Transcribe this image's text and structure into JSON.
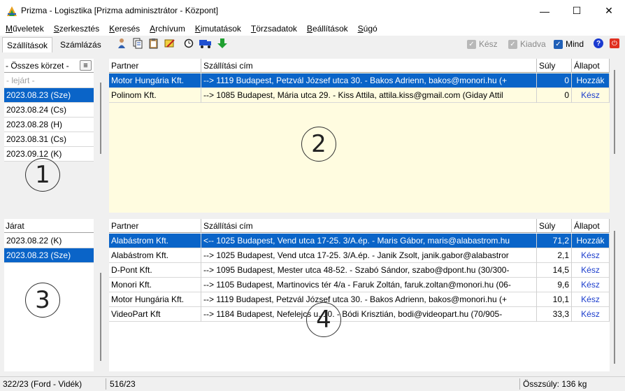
{
  "window": {
    "title": "Prizma - Logisztika [Prizma adminisztrátor - Központ]",
    "minimize": "—",
    "maximize": "☐",
    "close": "✕"
  },
  "menu": [
    {
      "label": "Műveletek",
      "u": "M",
      "rest": "űveletek"
    },
    {
      "label": "Szerkesztés",
      "u": "S",
      "rest": "zerkesztés"
    },
    {
      "label": "Keresés",
      "u": "K",
      "rest": "eresés"
    },
    {
      "label": "Archívum",
      "u": "A",
      "rest": "rchívum"
    },
    {
      "label": "Kimutatások",
      "u": "K",
      "rest": "imutatások"
    },
    {
      "label": "Törzsadatok",
      "u": "T",
      "rest": "örzsadatok"
    },
    {
      "label": "Beállítások",
      "u": "B",
      "rest": "eállítások"
    },
    {
      "label": "Súgó",
      "u": "S",
      "rest": "úgó"
    }
  ],
  "tabs": {
    "shipping": "Szállítások",
    "billing": "Számlázás"
  },
  "toolbar_icons": [
    "person-icon",
    "copy-icon",
    "clipboard-icon",
    "edit-icon",
    "clock-icon",
    "truck-icon",
    "down-arrow-icon"
  ],
  "checkboxes": {
    "done": "Kész",
    "issued": "Kiadva",
    "all": "Mind"
  },
  "help_icon": "?",
  "power_icon": "⏻",
  "districts": {
    "header": "- Összes körzet -",
    "menu_glyph": "≡",
    "items": [
      {
        "label": "- lejárt -",
        "state": "grayed"
      },
      {
        "label": "2023.08.23 (Sze)",
        "state": "selected"
      },
      {
        "label": "2023.08.24 (Cs)",
        "state": ""
      },
      {
        "label": "2023.08.28 (H)",
        "state": ""
      },
      {
        "label": "2023.08.31 (Cs)",
        "state": ""
      },
      {
        "label": "2023.09.12 (K)",
        "state": ""
      }
    ]
  },
  "routes": {
    "header": "Járat",
    "items": [
      {
        "label": "2023.08.22 (K)",
        "state": ""
      },
      {
        "label": "2023.08.23 (Sze)",
        "state": "selected"
      }
    ]
  },
  "grid_columns": {
    "partner": "Partner",
    "address": "Szállítási cím",
    "weight": "Súly",
    "status": "Állapot"
  },
  "grid_top": [
    {
      "partner": "Motor Hungária Kft.",
      "address": "--> 1119 Budapest, Petzvál József utca 30. - Bakos Adrienn, bakos@monori.hu (+",
      "weight": "0",
      "status": "Hozzák",
      "selected": true
    },
    {
      "partner": "Polinom Kft.",
      "address": "--> 1085 Budapest, Mária utca 29. - Kiss Attila, attila.kiss@gmail.com (Giday Attil",
      "weight": "0",
      "status": "Kész",
      "selected": false
    }
  ],
  "grid_bottom": [
    {
      "partner": "Alabástrom Kft.",
      "address": "<-- 1025 Budapest, Vend utca 17-25. 3/A.ép. - Maris Gábor, maris@alabastrom.hu",
      "weight": "71,2",
      "status": "Hozzák",
      "selected": true
    },
    {
      "partner": "Alabástrom Kft.",
      "address": "--> 1025 Budapest, Vend utca 17-25. 3/A.ép. - Janik Zsolt, janik.gabor@alabastror",
      "weight": "2,1",
      "status": "Kész",
      "selected": false
    },
    {
      "partner": "D-Pont Kft.",
      "address": "--> 1095 Budapest, Mester utca 48-52. - Szabó Sándor, szabo@dpont.hu (30/300-",
      "weight": "14,5",
      "status": "Kész",
      "selected": false
    },
    {
      "partner": "Monori Kft.",
      "address": "--> 1105 Budapest, Martinovics tér 4/a - Faruk Zoltán, faruk.zoltan@monori.hu (06-",
      "weight": "9,6",
      "status": "Kész",
      "selected": false
    },
    {
      "partner": "Motor Hungária Kft.",
      "address": "--> 1119 Budapest, Petzvál József utca 30. - Bakos Adrienn, bakos@monori.hu (+",
      "weight": "10,1",
      "status": "Kész",
      "selected": false
    },
    {
      "partner": "VideoPart Kft",
      "address": "--> 1184 Budapest, Nefelejcs u. 10. - Bódi Krisztián, bodi@videopart.hu (70/905-",
      "weight": "33,3",
      "status": "Kész",
      "selected": false
    }
  ],
  "callouts": [
    "1",
    "2",
    "3",
    "4"
  ],
  "status": {
    "left": "322/23 (Ford - Vidék)",
    "middle": "516/23",
    "total": "Összsúly: 136 kg"
  }
}
